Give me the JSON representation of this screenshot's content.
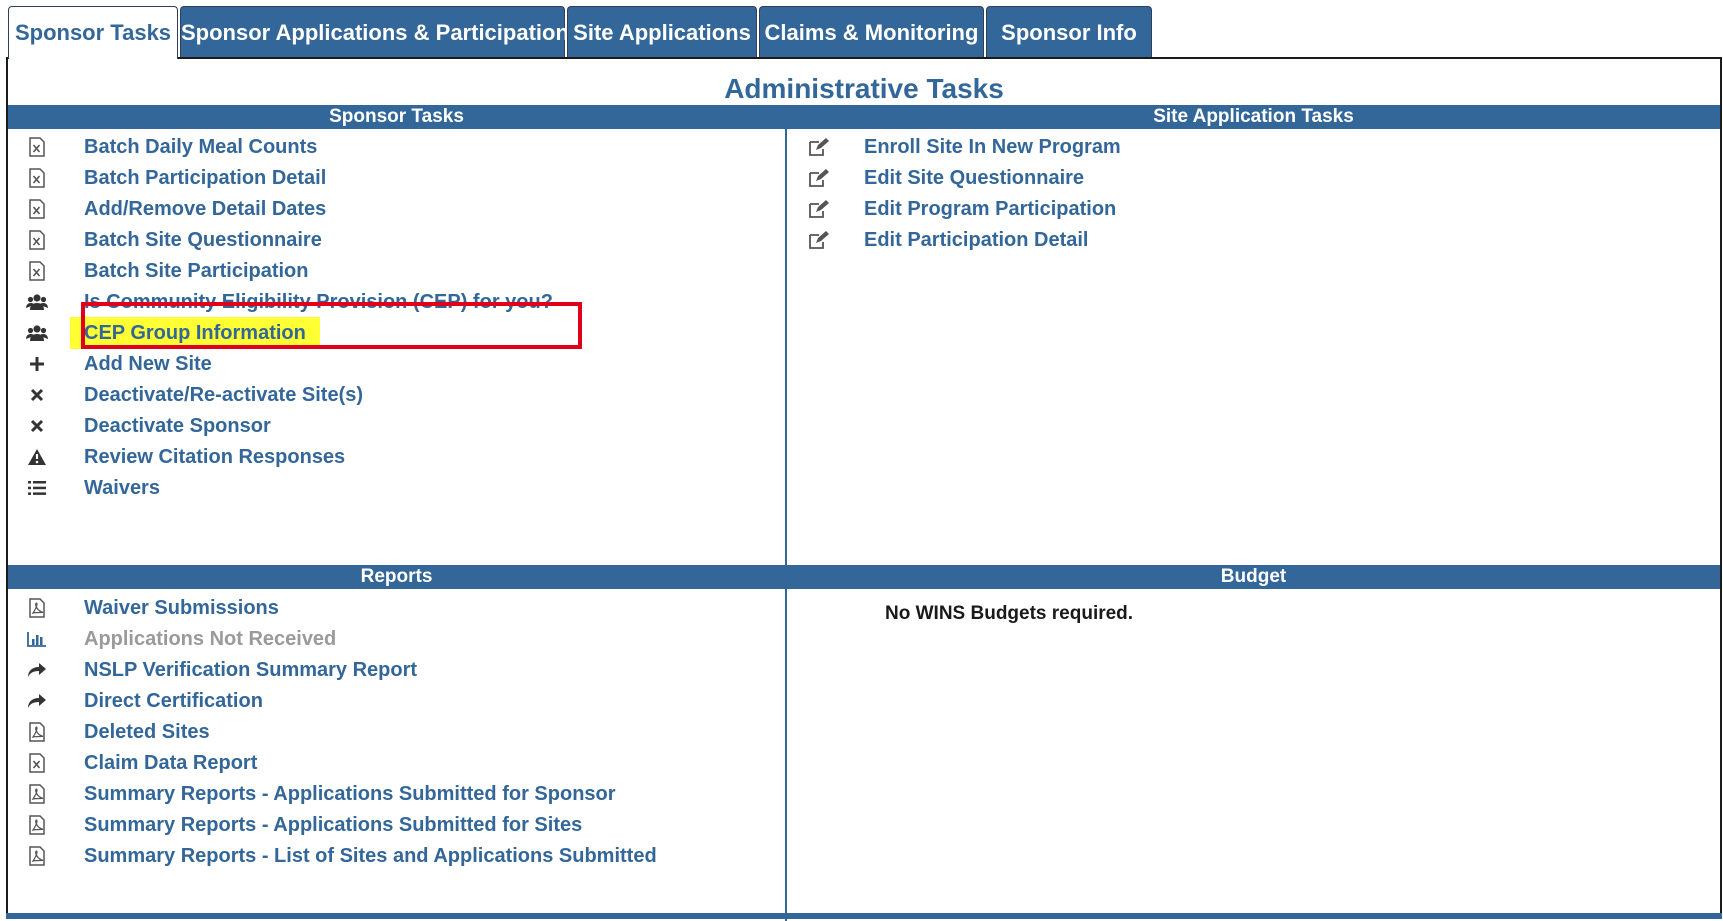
{
  "tabs": [
    {
      "label": "Sponsor Tasks",
      "active": true
    },
    {
      "label": "Sponsor Applications & Participation",
      "active": false
    },
    {
      "label": "Site Applications",
      "active": false
    },
    {
      "label": "Claims & Monitoring",
      "active": false
    },
    {
      "label": "Sponsor Info",
      "active": false
    }
  ],
  "page_title": "Administrative Tasks",
  "sections": {
    "sponsor_tasks": {
      "title": "Sponsor Tasks",
      "items": [
        {
          "label": "Batch Daily Meal Counts",
          "icon": "excel-file-icon"
        },
        {
          "label": "Batch Participation Detail",
          "icon": "excel-file-icon"
        },
        {
          "label": "Add/Remove Detail Dates",
          "icon": "excel-file-icon"
        },
        {
          "label": "Batch Site Questionnaire",
          "icon": "excel-file-icon"
        },
        {
          "label": "Batch Site Participation",
          "icon": "excel-file-icon"
        },
        {
          "label": "Is Community Eligibility Provision (CEP) for you?",
          "icon": "users-icon"
        },
        {
          "label": "CEP Group Information",
          "icon": "users-icon"
        },
        {
          "label": "Add New Site",
          "icon": "plus-icon"
        },
        {
          "label": "Deactivate/Re-activate Site(s)",
          "icon": "close-icon"
        },
        {
          "label": "Deactivate Sponsor",
          "icon": "close-icon"
        },
        {
          "label": "Review Citation Responses",
          "icon": "warning-icon"
        },
        {
          "label": "Waivers",
          "icon": "list-icon"
        }
      ]
    },
    "site_application_tasks": {
      "title": "Site Application Tasks",
      "items": [
        {
          "label": "Enroll Site In New Program",
          "icon": "edit-icon"
        },
        {
          "label": "Edit Site Questionnaire",
          "icon": "edit-icon"
        },
        {
          "label": "Edit Program Participation",
          "icon": "edit-icon"
        },
        {
          "label": "Edit Participation Detail",
          "icon": "edit-icon"
        }
      ]
    },
    "reports": {
      "title": "Reports",
      "items": [
        {
          "label": "Waiver Submissions",
          "icon": "pdf-file-icon"
        },
        {
          "label": "Applications Not Received",
          "icon": "bar-chart-icon"
        },
        {
          "label": "NSLP Verification Summary Report",
          "icon": "share-arrow-icon"
        },
        {
          "label": "Direct Certification",
          "icon": "share-arrow-icon"
        },
        {
          "label": "Deleted Sites",
          "icon": "pdf-file-icon"
        },
        {
          "label": "Claim Data Report",
          "icon": "excel-file-icon"
        },
        {
          "label": "Summary Reports - Applications Submitted for Sponsor",
          "icon": "pdf-file-icon"
        },
        {
          "label": "Summary Reports - Applications Submitted for Sites",
          "icon": "pdf-file-icon"
        },
        {
          "label": "Summary Reports - List of Sites and Applications Submitted",
          "icon": "pdf-file-icon"
        }
      ]
    },
    "budget": {
      "title": "Budget",
      "text": "No WINS Budgets required."
    }
  },
  "colors": {
    "accent": "#336699",
    "highlight": "#ffff33",
    "annotation_box": "#e0001b",
    "disabled_link": "#9a9a9a"
  }
}
